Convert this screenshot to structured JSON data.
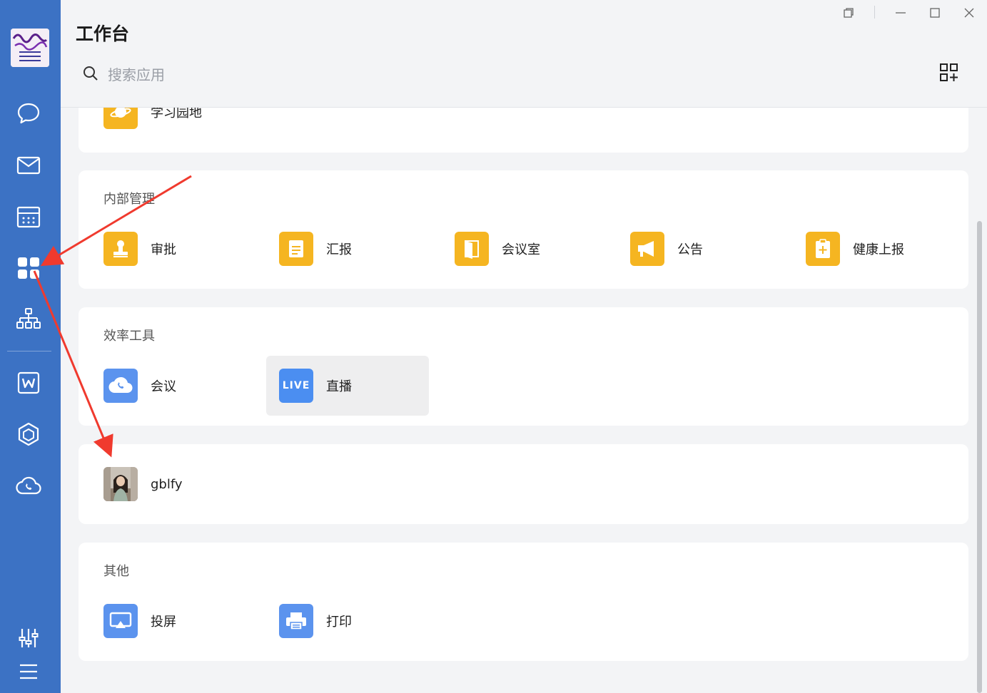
{
  "header": {
    "title": "工作台",
    "search_placeholder": "搜索应用"
  },
  "sidebar": {
    "items": [
      {
        "icon": "chat-icon"
      },
      {
        "icon": "mail-icon"
      },
      {
        "icon": "calendar-icon"
      },
      {
        "icon": "workbench-grid-icon",
        "active": true
      },
      {
        "icon": "org-chart-icon"
      },
      {
        "icon": "word-doc-icon"
      },
      {
        "icon": "cube-icon"
      },
      {
        "icon": "cloud-phone-icon"
      },
      {
        "icon": "settings-sliders-icon"
      },
      {
        "icon": "menu-icon"
      }
    ]
  },
  "sections": {
    "study": {
      "apps": [
        {
          "label": "学习园地",
          "icon": "planet-icon",
          "color": "#f5b521"
        }
      ]
    },
    "internal": {
      "title": "内部管理",
      "apps": [
        {
          "label": "审批",
          "icon": "stamp-icon",
          "color": "#f5b521"
        },
        {
          "label": "汇报",
          "icon": "document-icon",
          "color": "#f5b521"
        },
        {
          "label": "会议室",
          "icon": "door-icon",
          "color": "#f5b521"
        },
        {
          "label": "公告",
          "icon": "megaphone-icon",
          "color": "#f5b521"
        },
        {
          "label": "健康上报",
          "icon": "health-clipboard-icon",
          "color": "#f5b521"
        }
      ]
    },
    "efficiency": {
      "title": "效率工具",
      "apps": [
        {
          "label": "会议",
          "icon": "cloud-phone-icon",
          "color": "#5b93ee"
        },
        {
          "label": "直播",
          "icon": "live-icon",
          "icon_text": "LIVE",
          "color": "#4b8ef1"
        }
      ]
    },
    "custom": {
      "apps": [
        {
          "label": "gblfy",
          "icon": "photo-avatar-icon"
        }
      ]
    },
    "other": {
      "title": "其他",
      "apps": [
        {
          "label": "投屏",
          "icon": "screencast-icon",
          "color": "#5b93ee"
        },
        {
          "label": "打印",
          "icon": "printer-icon",
          "color": "#5b93ee"
        }
      ]
    }
  },
  "colors": {
    "sidebar": "#3c72c4",
    "accent_yellow": "#f5b521",
    "accent_blue": "#4b8ef1",
    "annotation_red": "#f03a2e"
  }
}
